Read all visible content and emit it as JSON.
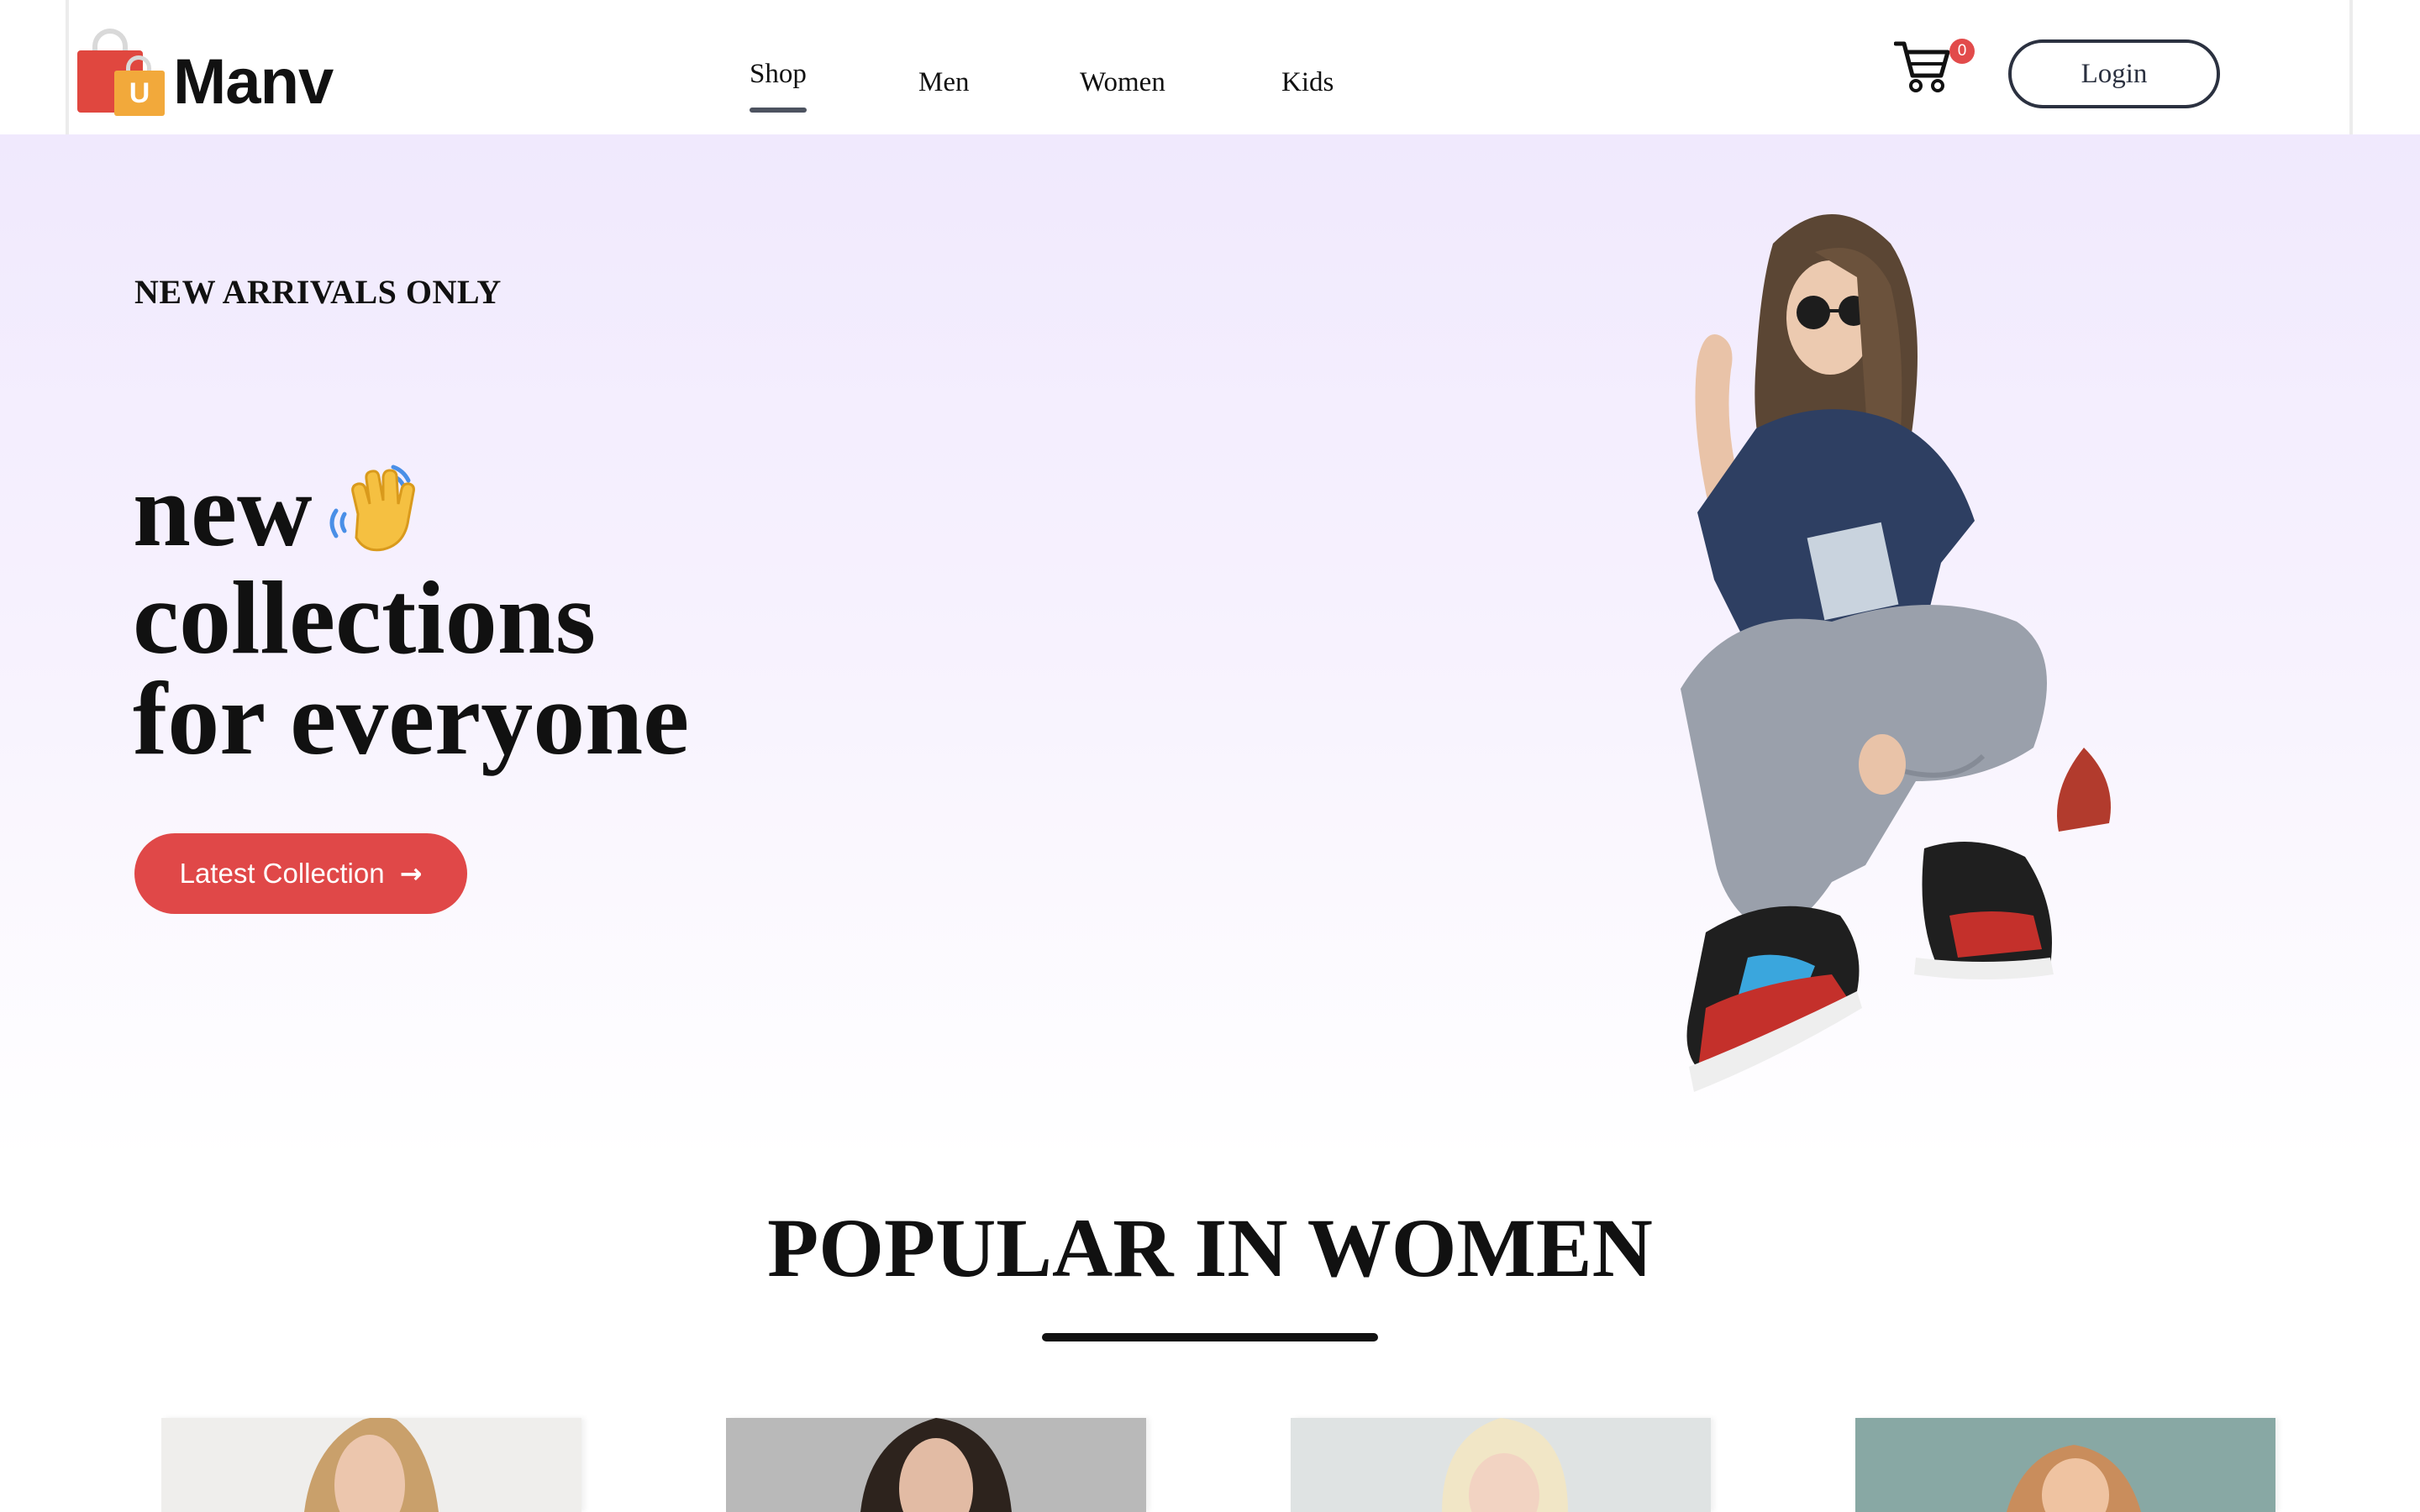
{
  "navbar": {
    "logo_text": "Manv",
    "logo_bag_letter": "U",
    "menu": [
      {
        "label": "Shop",
        "active": true
      },
      {
        "label": "Men",
        "active": false
      },
      {
        "label": "Women",
        "active": false
      },
      {
        "label": "Kids",
        "active": false
      }
    ],
    "cart_icon": "cart-icon",
    "cart_count": "0",
    "login_label": "Login"
  },
  "hero": {
    "eyebrow": "NEW ARRIVALS ONLY",
    "title_lines": [
      "new",
      "collections",
      "for everyone"
    ],
    "wave_icon": "waving-hand-icon",
    "cta_label": "Latest Collection",
    "cta_icon": "arrow-right-icon",
    "image": "model-sitting-photo"
  },
  "popular": {
    "title": "POPULAR IN WOMEN",
    "products": [
      {
        "image": "product-photo-1"
      },
      {
        "image": "product-photo-2"
      },
      {
        "image": "product-photo-3"
      },
      {
        "image": "product-photo-4"
      }
    ]
  },
  "colors": {
    "accent": "#e04848",
    "hero_bg_top": "#f0e9fd",
    "text": "#111111",
    "login_border": "#2b3140"
  }
}
